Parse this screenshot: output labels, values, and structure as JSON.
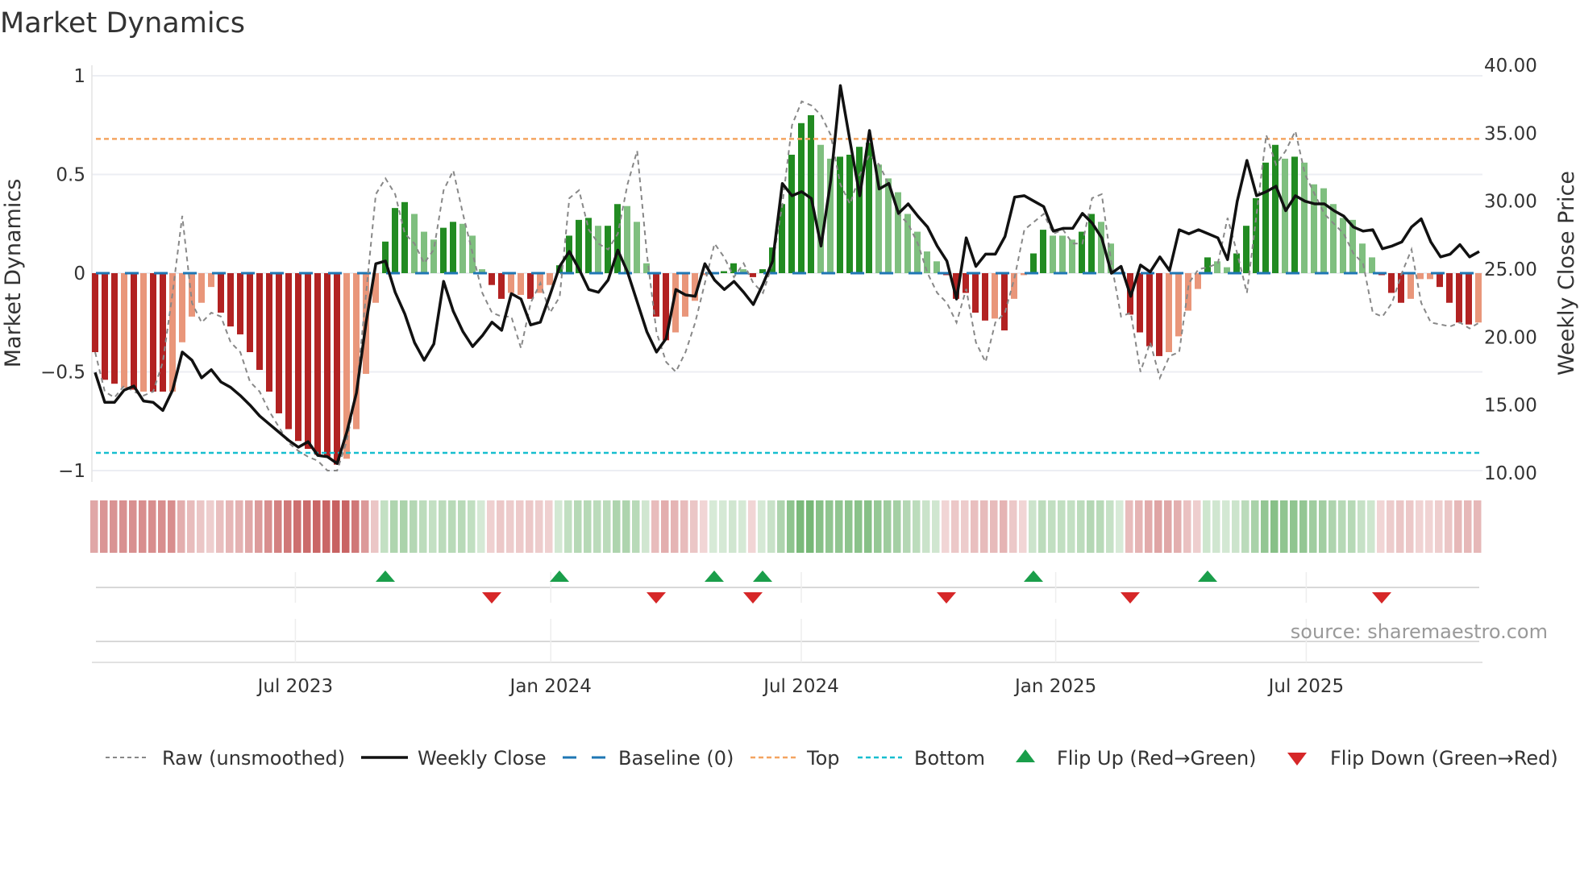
{
  "title": "Market Dynamics",
  "source": "source: sharemaestro.com",
  "colors": {
    "bar_neg_strong": "#b22222",
    "bar_neg_weak": "#e9967a",
    "bar_pos_strong": "#228b22",
    "bar_pos_weak": "#7fbf7f",
    "close": "#111111",
    "raw": "#888888",
    "baseline": "#1f77b4",
    "top": "#f4a460",
    "bottom": "#17becf",
    "flip_up": "#1a9e4a",
    "flip_down": "#d62728"
  },
  "chart_data": {
    "type": "bar",
    "title": "Market Dynamics",
    "ylabel": "Market Dynamics",
    "y2label": "Weekly Close Price",
    "ylim": [
      -1,
      1
    ],
    "y2lim": [
      10,
      40
    ],
    "yticks": [
      {
        "v": 1,
        "label": "1"
      },
      {
        "v": 0.5,
        "label": "0.5"
      },
      {
        "v": 0,
        "label": "0"
      },
      {
        "v": -0.5,
        "label": "−0.5"
      },
      {
        "v": -1,
        "label": "−1"
      }
    ],
    "y2ticks": [
      {
        "v": 40,
        "label": "40.00"
      },
      {
        "v": 35,
        "label": "35.00"
      },
      {
        "v": 30,
        "label": "30.00"
      },
      {
        "v": 25,
        "label": "25.00"
      },
      {
        "v": 20,
        "label": "20.00"
      },
      {
        "v": 15,
        "label": "15.00"
      },
      {
        "v": 10,
        "label": "10.00"
      }
    ],
    "xticks": [
      {
        "week": 20.7,
        "label": "Jul 2023"
      },
      {
        "week": 47.1,
        "label": "Jan 2024"
      },
      {
        "week": 73.0,
        "label": "Jul 2024"
      },
      {
        "week": 99.3,
        "label": "Jan 2025"
      },
      {
        "week": 125.2,
        "label": "Jul 2025"
      }
    ],
    "top_level": 0.68,
    "bottom_level": -0.91,
    "baseline": 0,
    "dynamics": [
      -0.4,
      -0.54,
      -0.56,
      -0.58,
      -0.59,
      -0.6,
      -0.6,
      -0.6,
      -0.6,
      -0.35,
      -0.22,
      -0.15,
      -0.07,
      -0.2,
      -0.27,
      -0.31,
      -0.4,
      -0.49,
      -0.6,
      -0.71,
      -0.79,
      -0.85,
      -0.89,
      -0.92,
      -0.93,
      -0.97,
      -0.94,
      -0.79,
      -0.51,
      -0.15,
      0.16,
      0.33,
      0.36,
      0.3,
      0.21,
      0.17,
      0.23,
      0.26,
      0.25,
      0.19,
      0.02,
      -0.06,
      -0.13,
      -0.1,
      -0.11,
      -0.13,
      -0.1,
      -0.06,
      0.04,
      0.19,
      0.27,
      0.28,
      0.24,
      0.24,
      0.35,
      0.34,
      0.26,
      0.05,
      -0.22,
      -0.34,
      -0.3,
      -0.22,
      -0.14,
      -0.01,
      0.0,
      0.01,
      0.05,
      0.02,
      -0.02,
      0.02,
      0.13,
      0.35,
      0.6,
      0.76,
      0.8,
      0.65,
      0.58,
      0.59,
      0.6,
      0.64,
      0.66,
      0.55,
      0.48,
      0.41,
      0.3,
      0.21,
      0.11,
      0.06,
      -0.01,
      -0.13,
      -0.1,
      -0.2,
      -0.24,
      -0.23,
      -0.29,
      -0.13,
      -0.01,
      0.1,
      0.22,
      0.19,
      0.19,
      0.17,
      0.21,
      0.3,
      0.26,
      0.15,
      0.0,
      -0.21,
      -0.3,
      -0.37,
      -0.42,
      -0.4,
      -0.32,
      -0.19,
      -0.08,
      0.08,
      0.06,
      0.03,
      0.1,
      0.24,
      0.38,
      0.56,
      0.65,
      0.58,
      0.59,
      0.56,
      0.45,
      0.43,
      0.35,
      0.28,
      0.27,
      0.15,
      0.08,
      -0.01,
      -0.1,
      -0.15,
      -0.13,
      -0.03,
      -0.03,
      -0.07,
      -0.15,
      -0.25,
      -0.26,
      -0.25
    ],
    "strength": "DDDLDLDDLLLLLDDDDDDDDDDDDDLLLLDDDLLLDDLLLDDLLDLLDDDDLDDLLLDDLLLLLDDLDDDDDDDLLDDDDLLLLLLLDDDDDLDLLDDLLLDDLLLDDDDLLLLDLLDDDDDLDLLLLLLLLDDDLLLDDDDL",
    "raw": [
      -0.4,
      -0.6,
      -0.63,
      -0.57,
      -0.6,
      -0.62,
      -0.6,
      -0.45,
      -0.1,
      0.29,
      -0.15,
      -0.25,
      -0.2,
      -0.22,
      -0.35,
      -0.4,
      -0.55,
      -0.6,
      -0.7,
      -0.78,
      -0.86,
      -0.9,
      -0.93,
      -0.95,
      -1.0,
      -1.0,
      -0.85,
      -0.6,
      -0.1,
      0.4,
      0.48,
      0.4,
      0.2,
      0.15,
      0.05,
      0.12,
      0.42,
      0.52,
      0.3,
      0.1,
      -0.1,
      -0.2,
      -0.22,
      -0.22,
      -0.38,
      -0.15,
      -0.05,
      -0.2,
      -0.12,
      0.38,
      0.42,
      0.22,
      0.15,
      0.12,
      0.2,
      0.45,
      0.62,
      0.1,
      -0.3,
      -0.45,
      -0.5,
      -0.4,
      -0.25,
      -0.05,
      0.15,
      0.08,
      -0.02,
      0.05,
      -0.05,
      -0.1,
      0.05,
      0.35,
      0.75,
      0.87,
      0.85,
      0.8,
      0.7,
      0.45,
      0.35,
      0.5,
      0.6,
      0.55,
      0.45,
      0.3,
      0.25,
      0.15,
      0.0,
      -0.1,
      -0.15,
      -0.25,
      -0.08,
      -0.35,
      -0.45,
      -0.25,
      -0.2,
      -0.02,
      0.22,
      0.26,
      0.3,
      0.2,
      0.22,
      0.15,
      0.15,
      0.38,
      0.4,
      0.05,
      -0.22,
      -0.2,
      -0.5,
      -0.35,
      -0.53,
      -0.42,
      -0.4,
      -0.05,
      0.02,
      0.03,
      0.05,
      0.28,
      0.1,
      -0.1,
      0.3,
      0.7,
      0.55,
      0.62,
      0.72,
      0.5,
      0.4,
      0.3,
      0.25,
      0.2,
      0.1,
      0.05,
      -0.2,
      -0.22,
      -0.15,
      0.0,
      0.12,
      -0.15,
      -0.25,
      -0.26,
      -0.27,
      -0.25,
      -0.28,
      -0.25
    ],
    "weekly_close": [
      17.4,
      15.2,
      15.2,
      16.1,
      16.4,
      15.3,
      15.2,
      14.6,
      16.1,
      18.9,
      18.3,
      17.0,
      17.6,
      16.7,
      16.3,
      15.7,
      15.0,
      14.2,
      13.6,
      13.0,
      12.4,
      11.9,
      12.3,
      11.3,
      11.2,
      10.7,
      13.0,
      15.9,
      21.1,
      25.4,
      25.6,
      23.3,
      21.7,
      19.6,
      18.3,
      19.5,
      24.1,
      21.9,
      20.4,
      19.3,
      20.1,
      21.1,
      20.5,
      23.2,
      22.8,
      20.9,
      21.1,
      23.1,
      25.2,
      26.3,
      25.0,
      23.5,
      23.3,
      24.2,
      26.4,
      24.8,
      22.6,
      20.4,
      18.9,
      19.9,
      23.5,
      23.1,
      23.0,
      25.4,
      24.2,
      23.5,
      24.1,
      23.3,
      22.4,
      23.9,
      25.6,
      31.3,
      30.4,
      30.7,
      30.2,
      26.7,
      31.5,
      38.5,
      34.4,
      30.4,
      35.2,
      30.9,
      31.3,
      29.1,
      29.8,
      28.9,
      28.1,
      26.7,
      25.6,
      22.8,
      27.3,
      25.2,
      26.1,
      26.1,
      27.4,
      30.3,
      30.4,
      30.0,
      29.6,
      27.8,
      28.0,
      28.0,
      29.1,
      28.4,
      27.3,
      24.7,
      25.2,
      23.0,
      25.3,
      24.8,
      25.9,
      24.9,
      27.9,
      27.6,
      27.9,
      27.6,
      27.3,
      25.7,
      30.0,
      33.0,
      30.4,
      30.7,
      31.1,
      29.3,
      30.4,
      30.0,
      29.8,
      29.8,
      29.3,
      28.9,
      28.1,
      27.8,
      27.9,
      26.5,
      26.7,
      27.0,
      28.1,
      28.7,
      27.0,
      25.9,
      26.1,
      26.8,
      25.9,
      26.3
    ],
    "flip_up_weeks": [
      30,
      48,
      64,
      69,
      97,
      115
    ],
    "flip_down_weeks": [
      41,
      58,
      68,
      88,
      107,
      133
    ]
  },
  "legend": {
    "raw": "Raw (unsmoothed)",
    "close": "Weekly Close",
    "baseline": "Baseline (0)",
    "top": "Top",
    "bottom": "Bottom",
    "flip_up": "Flip Up (Red→Green)",
    "flip_down": "Flip Down (Green→Red)"
  }
}
